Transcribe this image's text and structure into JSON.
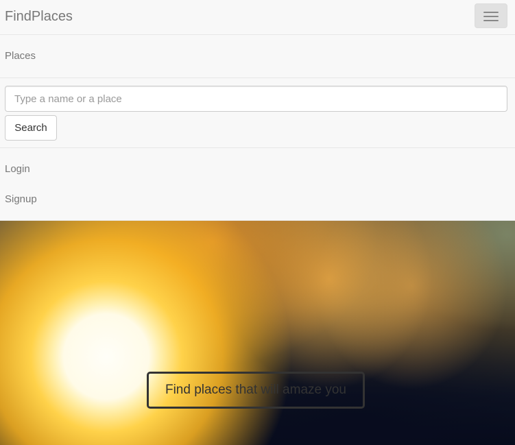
{
  "navbar": {
    "brand": "FindPlaces",
    "links": {
      "places": "Places",
      "login": "Login",
      "signup": "Signup"
    },
    "search": {
      "placeholder": "Type a name or a place",
      "value": "",
      "button_label": "Search"
    },
    "toggle_icon": "hamburger-icon"
  },
  "hero": {
    "cta_label": "Find places that will amaze you"
  },
  "colors": {
    "navbar_bg": "#f8f8f8",
    "link_text": "#777777",
    "cta_border": "#333333"
  }
}
